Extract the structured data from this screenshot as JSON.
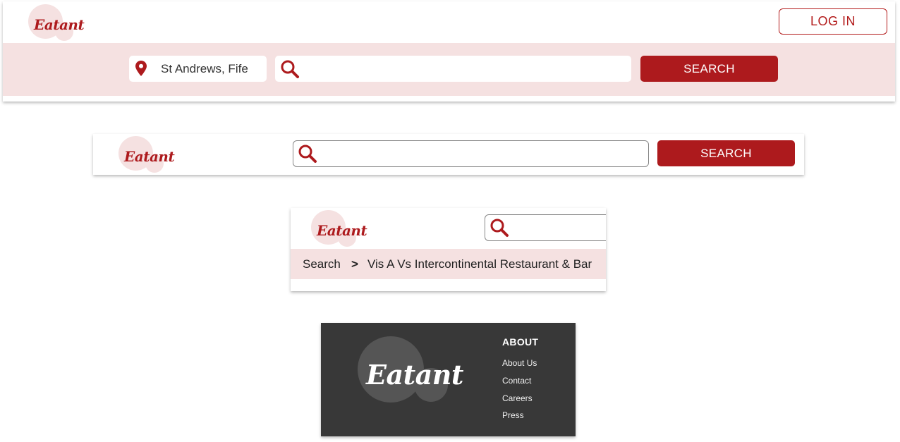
{
  "brand": {
    "name": "Eatant",
    "accent": "#ad1a1d",
    "band": "#f5e1e1",
    "logo_circle": "#f5e1e1",
    "footer_bg": "#383838"
  },
  "header_full": {
    "login_label": "LOG IN",
    "location_icon": "map-pin-icon",
    "location_value": "St Andrews, Fife",
    "search_icon": "search-icon",
    "search_placeholder": "",
    "search_label": "SEARCH"
  },
  "header_compact": {
    "search_icon": "search-icon",
    "search_placeholder": "",
    "search_label": "SEARCH"
  },
  "header_mobile": {
    "search_icon": "search-icon",
    "breadcrumb": {
      "root": "Search",
      "separator": ">",
      "current": "Vis A Vs Intercontinental Restaurant & Bar"
    }
  },
  "footer": {
    "about_title": "ABOUT",
    "links": [
      "About Us",
      "Contact",
      "Careers",
      "Press"
    ]
  }
}
